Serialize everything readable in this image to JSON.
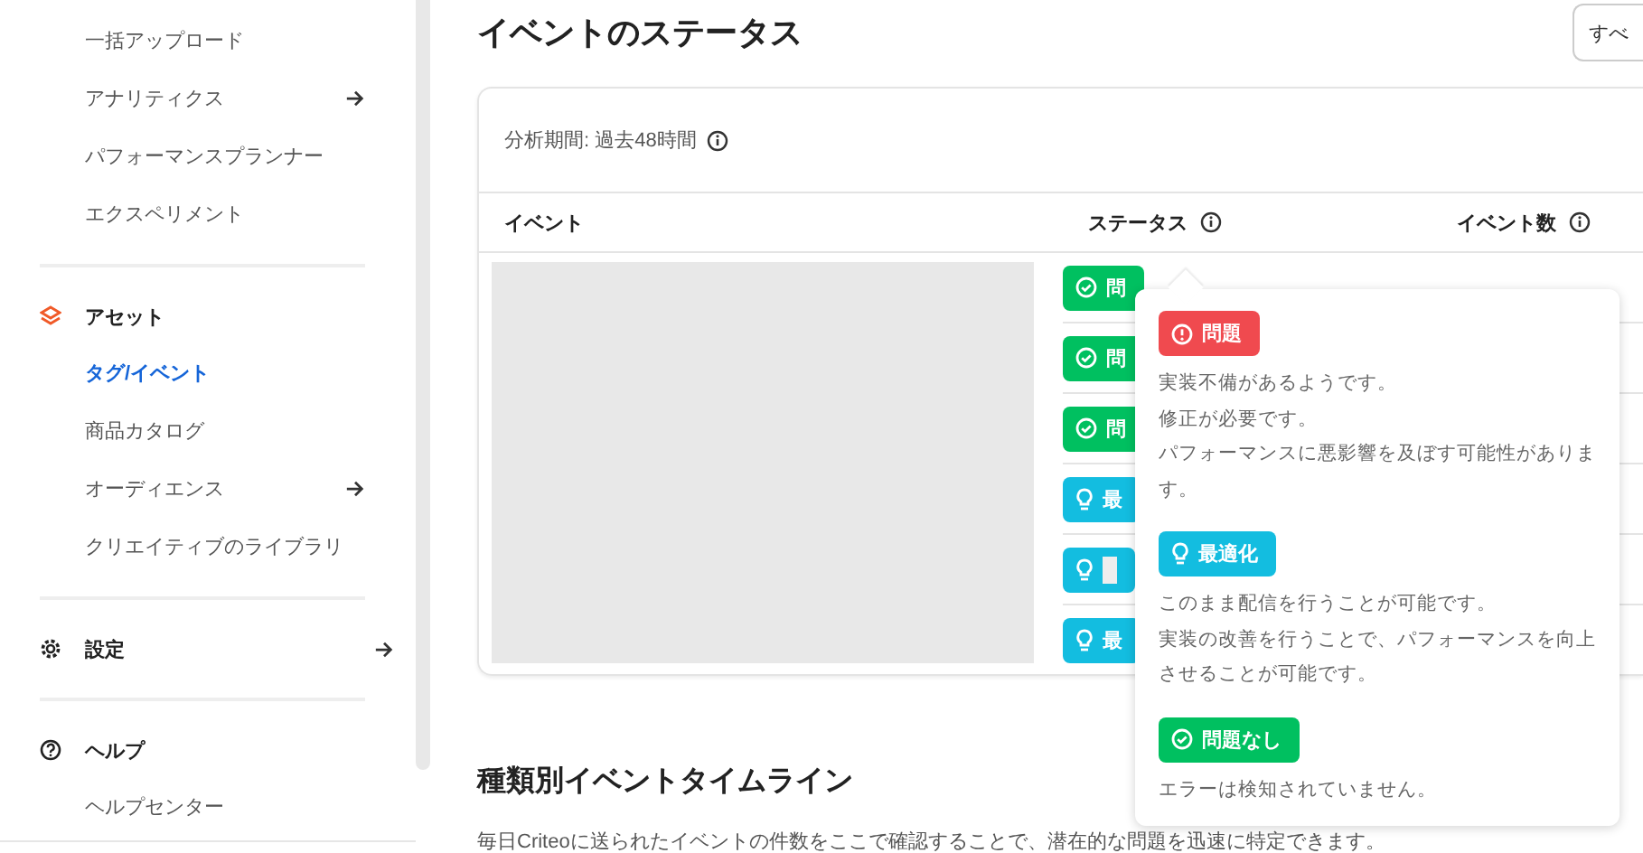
{
  "sidebar": {
    "sections": [
      {
        "items": [
          {
            "label": "一括アップロード",
            "selected": false,
            "submenu": false
          },
          {
            "label": "アナリティクス",
            "selected": false,
            "submenu": true
          },
          {
            "label": "パフォーマンスプランナー",
            "selected": false,
            "submenu": false
          },
          {
            "label": "エクスペリメント",
            "selected": false,
            "submenu": false
          }
        ]
      },
      {
        "title": "アセット",
        "submenu": false,
        "items": [
          {
            "label": "タグ/イベント",
            "selected": true,
            "submenu": false
          },
          {
            "label": "商品カタログ",
            "selected": false,
            "submenu": false
          },
          {
            "label": "オーディエンス",
            "selected": false,
            "submenu": true
          },
          {
            "label": "クリエイティブのライブラリ",
            "selected": false,
            "submenu": false
          }
        ]
      },
      {
        "title": "設定",
        "submenu": true
      },
      {
        "title": "ヘルプ",
        "submenu": false,
        "items": [
          {
            "label": "ヘルプセンター",
            "selected": false,
            "submenu": false
          }
        ]
      }
    ]
  },
  "page": {
    "title": "イベントのステータス",
    "filter_button": "すべ"
  },
  "card": {
    "period": "分析期間: 過去48時間",
    "columns": [
      "イベント",
      "ステータス",
      "イベント数"
    ],
    "rows": [
      {
        "kind": "ok",
        "status": "問",
        "redacted": false
      },
      {
        "kind": "ok",
        "status": "問",
        "redacted": false
      },
      {
        "kind": "ok",
        "status": "問",
        "redacted": false
      },
      {
        "kind": "optimize",
        "status": "最",
        "redacted": false
      },
      {
        "kind": "optimize",
        "redacted": true
      },
      {
        "kind": "optimize",
        "status": "最",
        "redacted": false
      }
    ]
  },
  "tooltip": [
    {
      "kind": "problem",
      "label": "問題",
      "lines": [
        "実装不備があるようです。",
        "修正が必要です。",
        "パフォーマンスに悪影響を及ぼす可能性があります。"
      ]
    },
    {
      "kind": "optimize",
      "label": "最適化",
      "lines": [
        "このまま配信を行うことが可能です。",
        "実装の改善を行うことで、パフォーマンスを向上させることが可能です。"
      ]
    },
    {
      "kind": "ok",
      "label": "問題なし",
      "lines": [
        "エラーは検知されていません。"
      ]
    }
  ],
  "timeline": {
    "title": "種類別イベントタイムライン",
    "description": "毎日Criteoに送られたイベントの件数をここで確認することで、潜在的な問題を迅速に特定できます。"
  }
}
